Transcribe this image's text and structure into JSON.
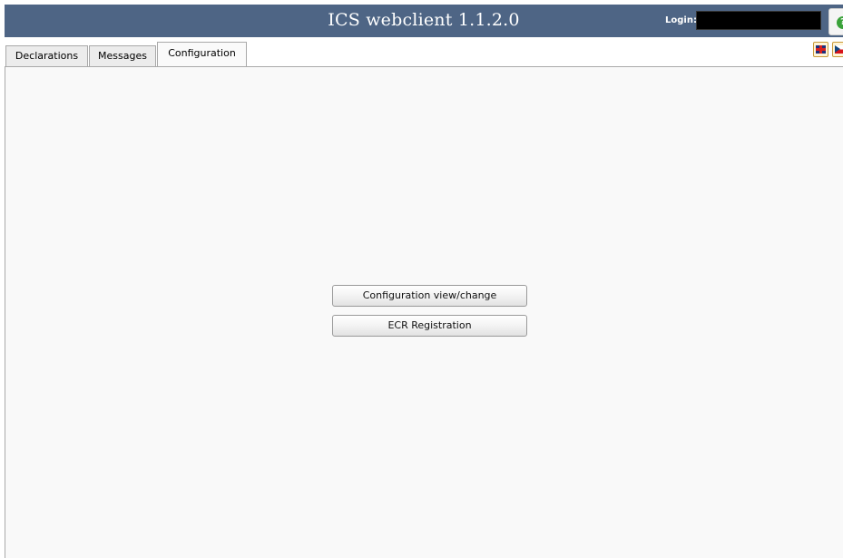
{
  "header": {
    "title": "ICS webclient 1.1.2.0",
    "login_label": "Login:",
    "login_value": "",
    "help_icon": "help-icon"
  },
  "tabs": [
    {
      "label": "Declarations",
      "active": false
    },
    {
      "label": "Messages",
      "active": false
    },
    {
      "label": "Configuration",
      "active": true
    }
  ],
  "language": {
    "flags": [
      "uk-flag-icon",
      "cz-flag-icon"
    ]
  },
  "configuration": {
    "buttons": [
      {
        "label": "Configuration view/change"
      },
      {
        "label": "ECR Registration"
      }
    ]
  },
  "colors": {
    "header_bg": "#4e6585",
    "header_text": "#ffffff",
    "content_bg": "#f9f9f9",
    "tab_bg": "#ececec",
    "tab_active_bg": "#fafafa",
    "help_icon": "#3aa23a"
  }
}
